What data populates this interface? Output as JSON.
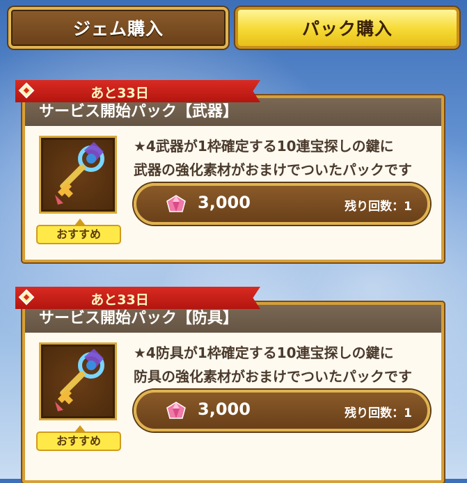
{
  "tabs": {
    "gem_purchase": "ジェム購入",
    "pack_purchase": "パック購入"
  },
  "packs": [
    {
      "days_left": "あと33日",
      "title": "サービス開始パック【武器】",
      "desc_line1": "★4武器が1枠確定する10連宝探しの鍵に",
      "desc_line2": "武器の強化素材がおまけでついたパックです",
      "price": "3,000",
      "remaining": "残り回数：1",
      "recommend": "おすすめ",
      "icon": "key-icon"
    },
    {
      "days_left": "あと33日",
      "title": "サービス開始パック【防具】",
      "desc_line1": "★4防具が1枠確定する10連宝探しの鍵に",
      "desc_line2": "防具の強化素材がおまけでついたパックです",
      "price": "3,000",
      "remaining": "残り回数：1",
      "recommend": "おすすめ",
      "icon": "key-icon"
    }
  ],
  "colors": {
    "ribbon": "#d92b22",
    "active_tab": "#f5d932",
    "panel_border": "#d6a038",
    "title_bar": "#6f5e4b"
  }
}
